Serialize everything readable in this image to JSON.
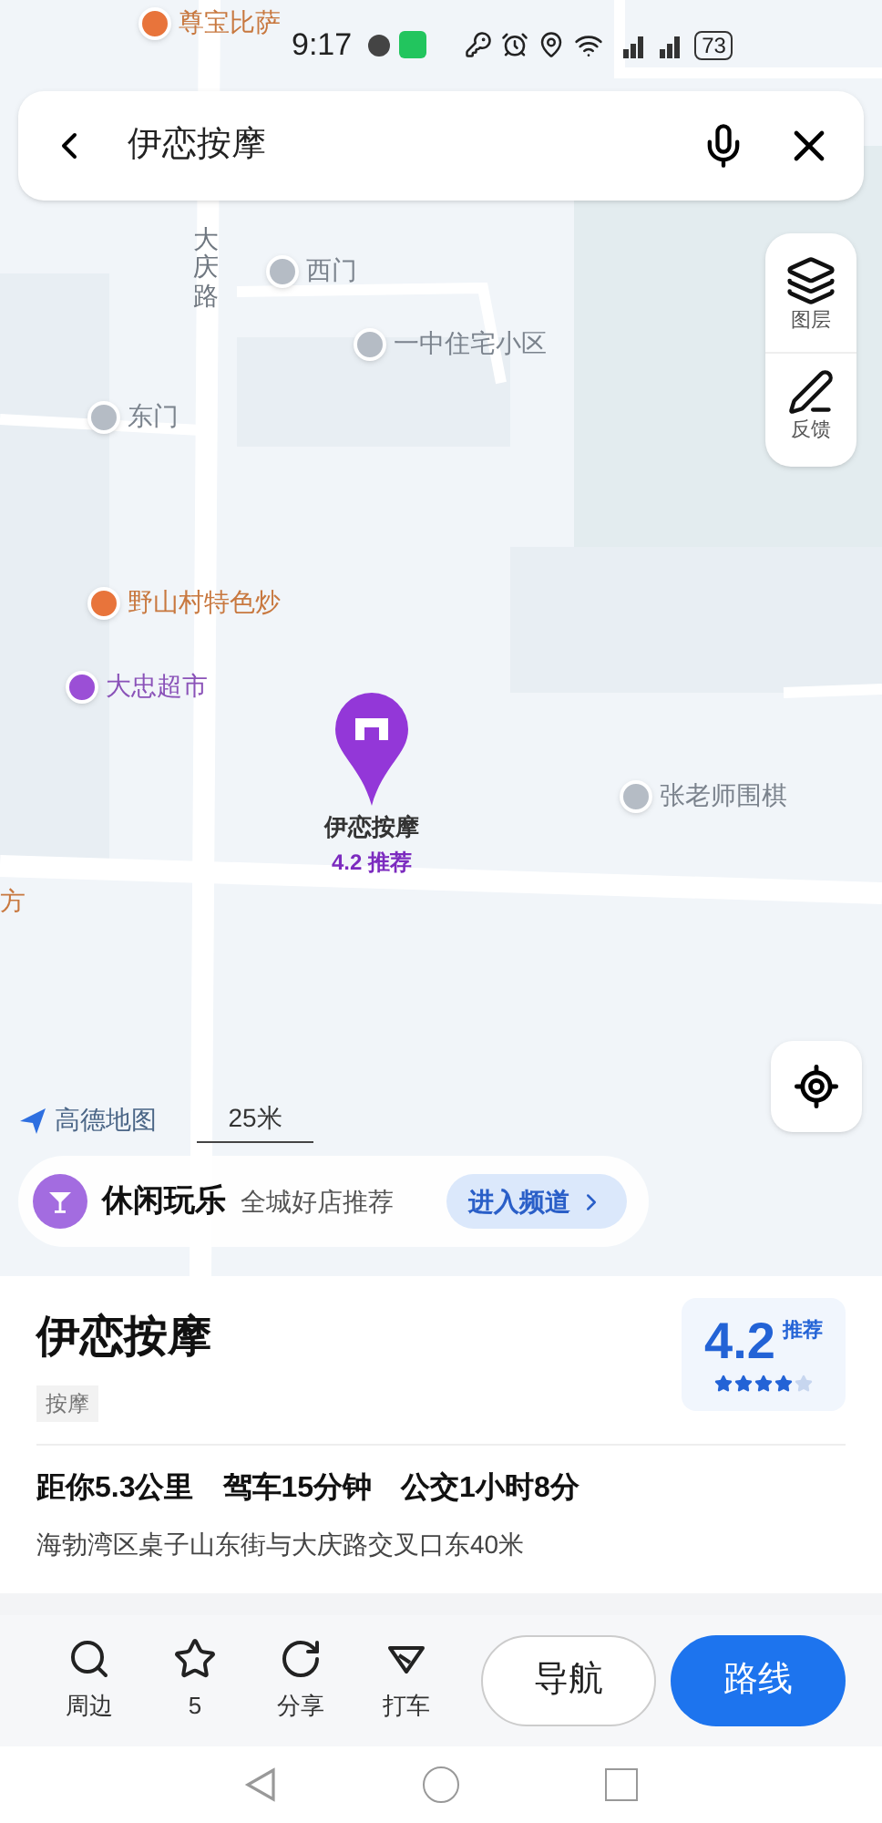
{
  "status_bar": {
    "time": "9:17",
    "battery": "73"
  },
  "search": {
    "value": "伊恋按摩"
  },
  "map": {
    "labels": [
      {
        "text": "尊宝比萨",
        "kind": "food"
      },
      {
        "text": "大庆路",
        "kind": "road"
      },
      {
        "text": "西门",
        "kind": "place"
      },
      {
        "text": "一中住宅小区",
        "kind": "place"
      },
      {
        "text": "东门",
        "kind": "place"
      },
      {
        "text": "野山村特色炒",
        "kind": "food"
      },
      {
        "text": "大忠超市",
        "kind": "shop"
      },
      {
        "text": "张老师围棋",
        "kind": "place"
      },
      {
        "text": "方",
        "kind": "plain"
      }
    ],
    "pin": {
      "name": "伊恋按摩",
      "rating": "4.2 推荐"
    },
    "tools": [
      {
        "label": "图层",
        "kind": "layers"
      },
      {
        "label": "反馈",
        "kind": "feedback"
      }
    ],
    "logo": "高德地图",
    "scale": "25米"
  },
  "promo": {
    "title": "休闲玩乐",
    "subtitle": "全城好店推荐",
    "button": "进入频道"
  },
  "place": {
    "name": "伊恋按摩",
    "category": "按摩",
    "score": "4.2",
    "score_label": "推荐",
    "stars": 4,
    "distance": "距你5.3公里",
    "drive": "驾车15分钟",
    "transit": "公交1小时8分",
    "address": "海勃湾区桌子山东街与大庆路交叉口东40米"
  },
  "actions": [
    {
      "label": "周边",
      "kind": "nearby"
    },
    {
      "label": "5",
      "kind": "favorite"
    },
    {
      "label": "分享",
      "kind": "share"
    },
    {
      "label": "打车",
      "kind": "taxi"
    }
  ],
  "buttons": [
    {
      "label": "导航",
      "kind": "secondary"
    },
    {
      "label": "路线",
      "kind": "primary"
    }
  ]
}
